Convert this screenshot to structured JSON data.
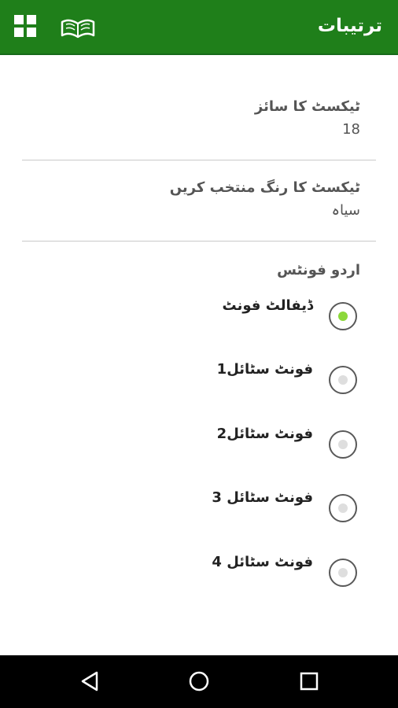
{
  "appbar": {
    "title": "ترتیبات",
    "left_icons": [
      "grid-icon",
      "open-book-icon"
    ],
    "background": "#1f7f1a"
  },
  "settings": [
    {
      "label": "ٹیکسٹ کا سائز",
      "value": "18"
    },
    {
      "label": "ٹیکسٹ کا رنگ منتخب کریں",
      "value": "سیاہ"
    }
  ],
  "fonts_section": {
    "title": "اردو فونٹس",
    "options": [
      {
        "label": "ڈیفالٹ فونٹ",
        "selected": true
      },
      {
        "label": "فونٹ سٹائل1",
        "selected": false
      },
      {
        "label": "فونٹ سٹائل2",
        "selected": false
      },
      {
        "label": "فونٹ سٹائل 3",
        "selected": false
      },
      {
        "label": "فونٹ سٹائل 4",
        "selected": false
      }
    ]
  },
  "navbar": {
    "buttons": [
      "back-icon",
      "home-icon",
      "recents-icon"
    ]
  },
  "colors": {
    "accent": "#8cd83a"
  }
}
